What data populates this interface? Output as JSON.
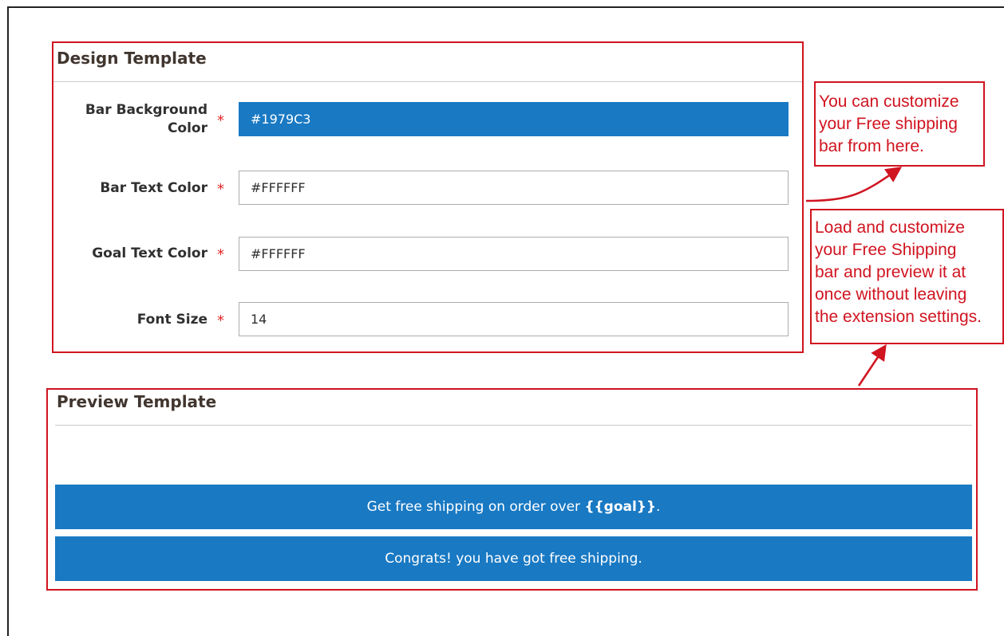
{
  "design_section": {
    "title": "Design Template",
    "fields": [
      {
        "label": "Bar Background Color",
        "label_line1": "Bar Background",
        "label_line2": "Color",
        "required_mark": "*",
        "value": "#1979C3"
      },
      {
        "label": "Bar Text Color",
        "required_mark": "*",
        "value": "#FFFFFF"
      },
      {
        "label": "Goal Text Color",
        "required_mark": "*",
        "value": "#FFFFFF"
      },
      {
        "label": "Font Size",
        "required_mark": "*",
        "value": "14"
      }
    ]
  },
  "preview_section": {
    "title": "Preview Template",
    "bars": [
      {
        "text_before": "Get free shipping on order over ",
        "goal": "{{goal}}",
        "text_after": "."
      },
      {
        "text": "Congrats! you have got free shipping."
      }
    ]
  },
  "annotations": {
    "callout_1": {
      "lines": [
        "You can customize",
        "your Free shipping",
        "bar from here."
      ]
    },
    "callout_2": {
      "lines": [
        "Load and customize",
        "your Free Shipping",
        "bar and preview it at",
        "once without leaving",
        "the extension settings."
      ]
    }
  },
  "colors": {
    "annotation_red": "#d01420",
    "bar_background": "#1979C3",
    "bar_text": "#FFFFFF",
    "required_star": "#e22626"
  }
}
